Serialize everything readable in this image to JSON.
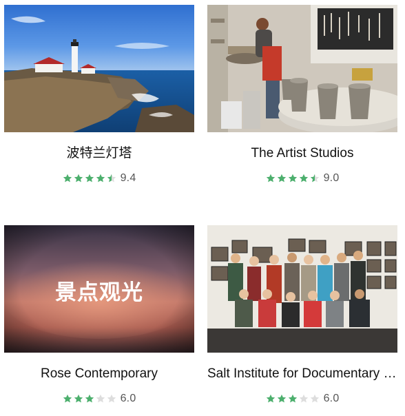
{
  "cards": [
    {
      "title": "波特兰灯塔",
      "score": "9.4",
      "rating": 4.5,
      "image": "lighthouse-photo"
    },
    {
      "title": "The Artist Studios",
      "score": "9.0",
      "rating": 4.5,
      "image": "pottery-studio-photo"
    },
    {
      "title": "Rose Contemporary",
      "score": "6.0",
      "rating": 3,
      "image": "placeholder-blurred",
      "overlay_text": "景点观光"
    },
    {
      "title": "Salt Institute for Documentary Studies",
      "score": "6.0",
      "rating": 3,
      "image": "group-gallery-photo"
    }
  ],
  "colors": {
    "star_filled": "#4caf6d",
    "star_empty": "#dddddd",
    "score_text": "#555555"
  }
}
